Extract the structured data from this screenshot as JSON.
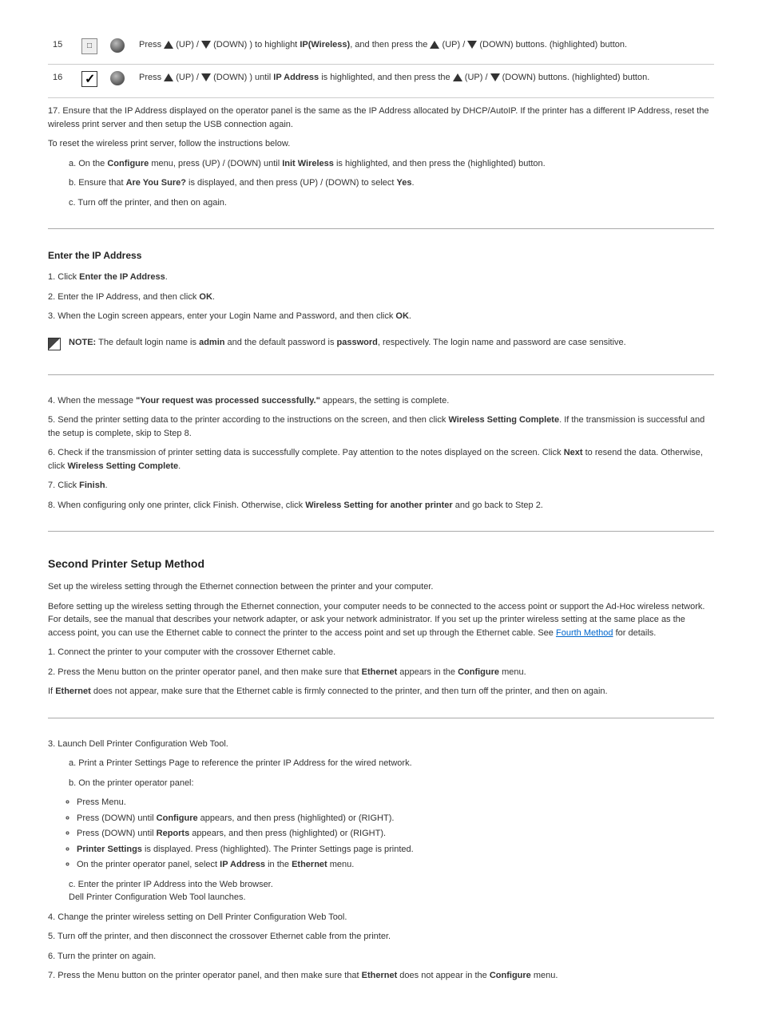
{
  "table": {
    "row1": {
      "step": "15",
      "text_a": "Press",
      "text_b": "(",
      "text_c": ") to highlight",
      "ip_wireless": "IP(Wireless)",
      "text_d": ", and then press the",
      "up": "(UP)",
      "down": "(DOWN)",
      "buttons": "buttons.",
      "text_e": "(highlighted) button."
    },
    "row2": {
      "step": "16",
      "text_a": "Press",
      "text_b": "(",
      "text_c": ") until",
      "text_d": "is highlighted, and then press the",
      "ip_address": "IP Address",
      "buttons": "buttons.",
      "text_e": "(highlighted) button.",
      "up": "(UP)",
      "down": "(DOWN)"
    }
  },
  "step17": {
    "num": "17.",
    "text_a": "Ensure that the IP Address displayed on the operator panel is the same as the IP Address allocated by DHCP/AutoIP. If the printer has a different IP Address, reset the wireless print server and then setup the USB connection again.",
    "text_b": "To reset the wireless print server, follow the instructions below."
  },
  "sub_a": {
    "num": "a.",
    "text_a": "On the",
    "menu": "Configure",
    "text_b": "menu, press",
    "up": "(UP)",
    "down": "(DOWN)",
    "text_c": "until",
    "item": "Init Wireless",
    "text_d": "is highlighted, and then press the",
    "text_e": "(highlighted) button."
  },
  "sub_b": {
    "num": "b.",
    "text": "Ensure that",
    "item": "Are You Sure?",
    "text2": "is displayed, and then press",
    "up": "(UP)",
    "down": "(DOWN)",
    "text3": "to select",
    "yes": "Yes",
    "period": "."
  },
  "sub_c": {
    "num": "c.",
    "text": "Turn off the printer, and then on again."
  },
  "sec2": {
    "heading": "Enter the IP Address",
    "step1": {
      "num": "1.",
      "text": "Click",
      "btn": "Enter the IP Address",
      "period": "."
    },
    "step2": {
      "num": "2.",
      "text": "Enter the IP Address, and then click",
      "btn": "OK",
      "period": "."
    },
    "step3": {
      "num": "3.",
      "text": "When the Login screen appears, enter your Login Name and Password, and then click",
      "btn": "OK",
      "period": "."
    }
  },
  "note": {
    "label": "NOTE:",
    "text_a": "The default login name is",
    "admin": "admin",
    "text_b": "and the default password is",
    "password": "password",
    "text_c": ", respectively. The login name and password are case sensitive."
  },
  "step4": {
    "num": "4.",
    "text": "When the message",
    "msg": "\"Your request was processed successfully.\"",
    "text2": "appears, the setting is complete."
  },
  "step5": {
    "num": "5.",
    "text_a": "Send the printer setting data to the printer according to the instructions on the screen, and then click",
    "btn": "Wireless Setting Complete",
    "text_b": ". If the transmission is successful and the setup is complete, skip to Step 8."
  },
  "step6": {
    "num": "6.",
    "text_a": "Check if the transmission of printer setting data is successfully complete. Pay attention to the notes displayed on the screen. Click",
    "btn": "Next",
    "text_b": " to resend the data. Otherwise, click",
    "btn2": "Wireless Setting Complete",
    "period": "."
  },
  "step7": {
    "num": "7.",
    "text": "Click",
    "btn": "Finish",
    "period": "."
  },
  "step8": {
    "num": "8.",
    "text": "When configuring only one printer, click Finish. Otherwise, click",
    "btn": "Wireless Setting for another printer",
    "text2": "and go back to Step 2."
  },
  "sec3": {
    "heading": "Second Printer Setup Method",
    "para1": "Set up the wireless setting through the Ethernet connection between the printer and your computer.",
    "para2_a": "Before setting up the wireless setting through the Ethernet connection, your computer needs to be connected to the access point or support the Ad-Hoc wireless network. For details, see the manual that describes your network adapter, or ask your network administrator. If you set up the printer wireless setting at the same place as the access point, you can use the Ethernet cable to connect the printer to the access point and set up through the Ethernet cable. See",
    "link": "Fourth Method",
    "para2_b": " for details.",
    "step1": {
      "num": "1.",
      "text": "Connect the printer to your computer with the crossover Ethernet cable."
    },
    "step2": {
      "num": "2.",
      "text": "Press the Menu button on the printer operator panel, and then make sure that",
      "item": "Ethernet",
      "text2": "appears in the",
      "menu": "Configure",
      "text3": "menu."
    },
    "para3": "If",
    "para3_item": "Ethernet",
    "para3_b": "does not appear, make sure that the Ethernet cable is firmly connected to the printer, and then turn off the printer, and then on again.",
    "step3": {
      "num": "3.",
      "text": "Launch Dell Printer Configuration Web Tool."
    }
  },
  "sub3a": {
    "num": "a.",
    "text": "Print a Printer Settings Page to reference the printer IP Address for the wired network."
  },
  "sub3b": {
    "num": "b.",
    "text": "On the printer operator panel:"
  },
  "menu_list": {
    "i1": "Press Menu.",
    "i2_a": "Press",
    "i2_down": "(DOWN)",
    "i2_b": "until",
    "i2_item": "Configure",
    "i2_c": "appears, and then press",
    "i2_btn": "(highlighted)",
    "i2_d": " or ",
    "i2_right": "(RIGHT)",
    "i2_e": ".",
    "i3_a": "Press",
    "i3_down": "(DOWN)",
    "i3_b": "until",
    "i3_item": "Reports",
    "i3_c": "appears, and then press",
    "i3_btn": "(highlighted)",
    "i3_d": " or ",
    "i3_right": "(RIGHT)",
    "i3_e": ".",
    "i4_a": "",
    "i4_item": "Printer Settings",
    "i4_b": "is displayed. Press",
    "i4_btn": "(highlighted)",
    "i4_c": ". The Printer Settings page is printed.",
    "i5_a": "On the printer operator panel, select",
    "i5_item": "IP Address",
    "i5_b": "in the",
    "i5_menu": "Ethernet",
    "i5_c": "menu."
  },
  "sub3c": {
    "num": "c.",
    "text": "Enter the printer IP Address into the Web browser.",
    "text2": "Dell Printer Configuration Web Tool launches."
  },
  "step4_2": {
    "num": "4.",
    "text": "Change the printer wireless setting on Dell Printer Configuration Web Tool."
  },
  "step5_2": {
    "num": "5.",
    "text": "Turn off the printer, and then disconnect the crossover Ethernet cable from the printer."
  },
  "step6_2": {
    "num": "6.",
    "text": "Turn the printer on again."
  },
  "step7_2": {
    "num": "7.",
    "text": "Press the Menu button on the printer operator panel, and then make sure that",
    "item": "Ethernet",
    "text2": "does not appear in the",
    "menu": "Configure",
    "text3": "menu."
  }
}
